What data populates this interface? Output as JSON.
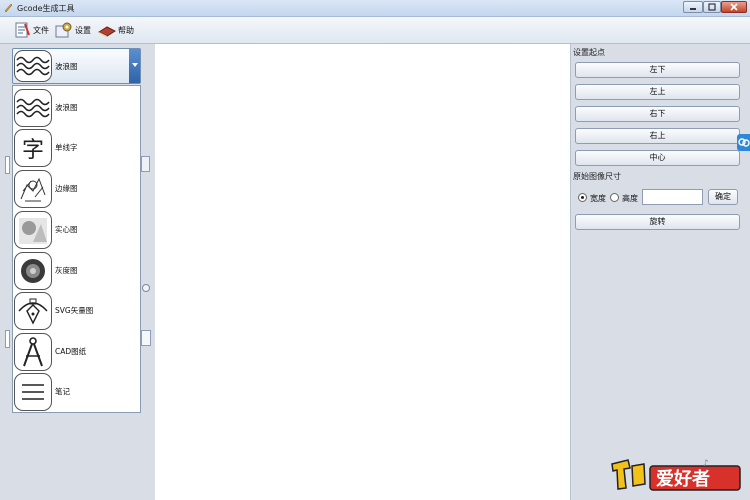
{
  "window": {
    "title": "Gcode生成工具"
  },
  "toolbar": {
    "file": "文件",
    "settings": "设置",
    "help": "帮助"
  },
  "mode_dropdown": {
    "selected": "波浪图",
    "options": [
      "波浪图",
      "单线字",
      "边缘图",
      "实心图",
      "灰度图",
      "SVG矢量图",
      "CAD图纸",
      "笔记"
    ],
    "glyph_char": "字"
  },
  "right_panel": {
    "origin_title": "设置起点",
    "origin_buttons": [
      "左下",
      "左上",
      "右下",
      "右上",
      "中心"
    ],
    "size_title": "原始图像尺寸",
    "width_label": "宽度",
    "height_label": "高度",
    "size_value": "",
    "confirm_label": "确定",
    "rotate_label": "旋转"
  },
  "watermark": {
    "text": "爱好者"
  }
}
